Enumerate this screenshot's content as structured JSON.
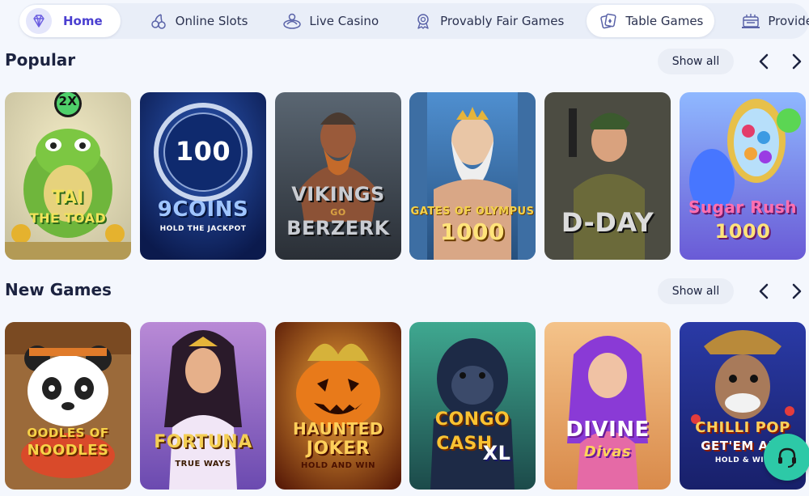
{
  "nav": {
    "items": [
      {
        "label": "Home",
        "icon": "diamond-icon"
      },
      {
        "label": "Online Slots",
        "icon": "cherries-icon"
      },
      {
        "label": "Live Casino",
        "icon": "live-dealer-icon"
      },
      {
        "label": "Provably Fair Games",
        "icon": "shield-badge-icon"
      },
      {
        "label": "Table Games",
        "icon": "cards-icon"
      },
      {
        "label": "Providers",
        "icon": "provider-building-icon"
      }
    ],
    "active": "Home"
  },
  "sections": [
    {
      "title": "Popular",
      "show_all_label": "Show all",
      "games": [
        {
          "name": "Tai the Toad",
          "badge": "2X"
        },
        {
          "name": "9 Coins Hold the Jackpot",
          "value": "100"
        },
        {
          "name": "Vikings Go Berzerk"
        },
        {
          "name": "Gates of Olympus 1000"
        },
        {
          "name": "D-Day"
        },
        {
          "name": "Sugar Rush 1000"
        }
      ]
    },
    {
      "title": "New Games",
      "show_all_label": "Show all",
      "games": [
        {
          "name": "Oodles of Noodles"
        },
        {
          "name": "Fortuna True Ways"
        },
        {
          "name": "Haunted Joker Hold and Win"
        },
        {
          "name": "Congo Cash XL"
        },
        {
          "name": "Divine Divas"
        },
        {
          "name": "Chilli Pop Get'em All Hold & Win"
        }
      ]
    }
  ],
  "card_text": {
    "tai_line1": "TAI",
    "tai_line2": "THE TOAD",
    "coins_value": "100",
    "coins_name": "9COINS",
    "coins_sub": "HOLD THE JACKPOT",
    "vikings_line1": "VIKINGS",
    "vikings_line2": "GO",
    "vikings_line3": "BERZERK",
    "olympus_line1": "GATES OF OLYMPUS",
    "olympus_line2": "1000",
    "dday": "D-DAY",
    "sugar_line1": "Sugar Rush",
    "sugar_line2": "1000",
    "oodles_line1": "OODLES OF",
    "oodles_line2": "NOODLES",
    "fortuna_line1": "FORTUNA",
    "fortuna_line2": "TRUE WAYS",
    "haunted_line1": "HAUNTED",
    "haunted_line2": "JOKER",
    "haunted_line3": "HOLD AND WIN",
    "congo_line1": "CONGO",
    "congo_line2": "CASH",
    "congo_line3": "XL",
    "divine_line1": "DIVINE",
    "divine_line2": "Divas",
    "chilli_line1": "CHILLI POP",
    "chilli_line2": "GET'EM ALL",
    "chilli_line3": "HOLD & WIN",
    "badge_2x": "2X"
  },
  "support": {
    "icon": "headset-icon"
  },
  "colors": {
    "accent": "#4a3fd0",
    "background": "#f4f7fd",
    "nav_bg": "#e9eef8",
    "support": "#2dc9a7"
  }
}
